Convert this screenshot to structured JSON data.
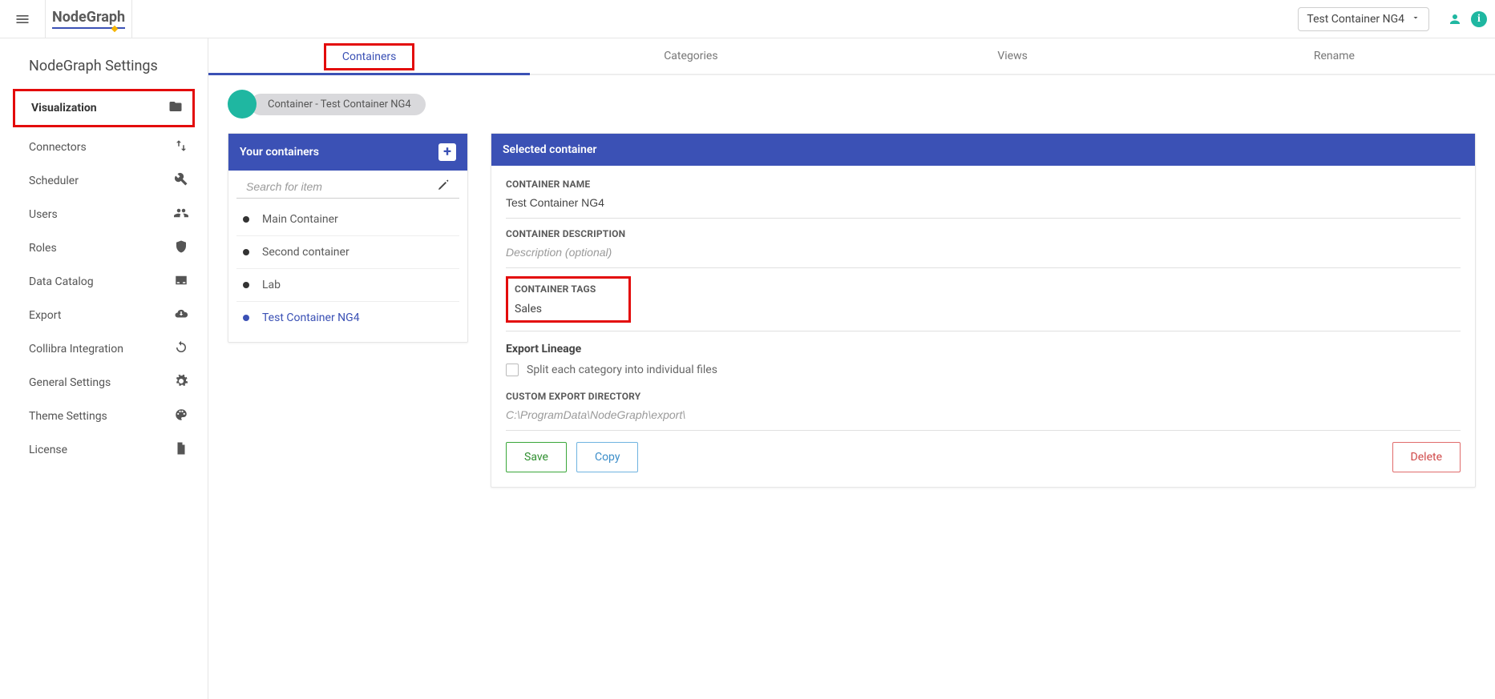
{
  "header": {
    "logo_text": "NodeGraph",
    "selected_container": "Test Container NG4"
  },
  "sidebar": {
    "section_title": "NodeGraph Settings",
    "items": [
      {
        "label": "Visualization",
        "icon": "folder-icon",
        "active": true
      },
      {
        "label": "Connectors",
        "icon": "swap-icon"
      },
      {
        "label": "Scheduler",
        "icon": "wrench-icon"
      },
      {
        "label": "Users",
        "icon": "people-icon"
      },
      {
        "label": "Roles",
        "icon": "shield-icon"
      },
      {
        "label": "Data Catalog",
        "icon": "inbox-icon"
      },
      {
        "label": "Export",
        "icon": "cloud-icon"
      },
      {
        "label": "Collibra Integration",
        "icon": "sync-icon"
      },
      {
        "label": "General Settings",
        "icon": "gear-icon"
      },
      {
        "label": "Theme Settings",
        "icon": "palette-icon"
      },
      {
        "label": "License",
        "icon": "file-icon"
      }
    ]
  },
  "tabs": [
    {
      "label": "Containers",
      "active": true
    },
    {
      "label": "Categories"
    },
    {
      "label": "Views"
    },
    {
      "label": "Rename"
    }
  ],
  "breadcrumb": {
    "label": "Container - Test Container NG4"
  },
  "left_panel": {
    "title": "Your containers",
    "search_placeholder": "Search for item",
    "items": [
      {
        "label": "Main Container"
      },
      {
        "label": "Second container"
      },
      {
        "label": "Lab"
      },
      {
        "label": "Test Container NG4",
        "selected": true
      }
    ]
  },
  "right_panel": {
    "title": "Selected container",
    "container_name_label": "CONTAINER NAME",
    "container_name_value": "Test Container NG4",
    "container_desc_label": "CONTAINER DESCRIPTION",
    "container_desc_placeholder": "Description (optional)",
    "container_tags_label": "CONTAINER TAGS",
    "container_tags_value": "Sales",
    "export_lineage_label": "Export Lineage",
    "split_checkbox_label": "Split each category into individual files",
    "custom_export_label": "CUSTOM EXPORT DIRECTORY",
    "custom_export_placeholder": "C:\\ProgramData\\NodeGraph\\export\\",
    "save_label": "Save",
    "copy_label": "Copy",
    "delete_label": "Delete"
  }
}
